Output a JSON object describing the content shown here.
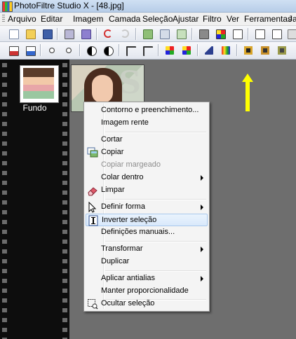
{
  "window": {
    "title": "PhotoFiltre Studio X - [48.jpg]"
  },
  "menubar": {
    "items": [
      "Arquivo",
      "Editar",
      "Imagem",
      "Camada",
      "Seleção",
      "Ajustar",
      "Filtro",
      "Ver",
      "Ferramentas",
      "Ja"
    ]
  },
  "filmstrip": {
    "thumbnail_label": "Fundo"
  },
  "context_menu": {
    "items": [
      {
        "label": "Contorno e preenchimento..."
      },
      {
        "label": "Imagem rente"
      },
      {
        "label": "Cortar"
      },
      {
        "label": "Copiar"
      },
      {
        "label": "Copiar margeado"
      },
      {
        "label": "Colar dentro"
      },
      {
        "label": "Limpar"
      },
      {
        "label": "Definir forma"
      },
      {
        "label": "Inverter seleção"
      },
      {
        "label": "Definições manuais..."
      },
      {
        "label": "Transformar"
      },
      {
        "label": "Duplicar"
      },
      {
        "label": "Aplicar antialias"
      },
      {
        "label": "Manter proporcionalidade"
      },
      {
        "label": "Ocultar seleção"
      }
    ]
  },
  "colors": {
    "workspace": "#6e6e6e",
    "filmstrip": "#0d0d0d",
    "highlight": "#d9e9fb",
    "arrow": "#ffff00"
  }
}
